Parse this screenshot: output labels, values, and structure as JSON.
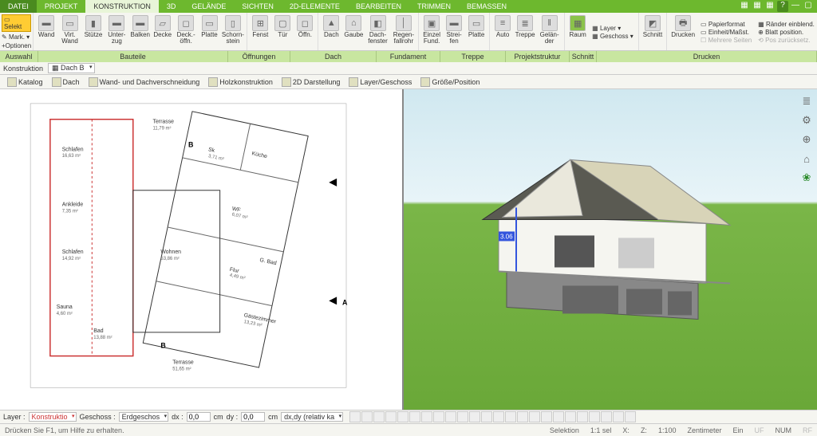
{
  "tabs": {
    "file": "DATEI",
    "list": [
      "PROJEKT",
      "KONSTRUKTION",
      "3D",
      "GELÄNDE",
      "SICHTEN",
      "2D-ELEMENTE",
      "BEARBEITEN",
      "TRIMMEN",
      "BEMASSEN"
    ],
    "active": "KONSTRUKTION"
  },
  "leftcol": {
    "select": "Selekt",
    "mark": "Mark.",
    "options": "+Optionen"
  },
  "ribbon": {
    "bauteile": [
      "Wand",
      "Virt. Wand",
      "Stütze",
      "Unter-zug",
      "Balken",
      "Decke",
      "Deck.-öffn.",
      "Platte",
      "Schorn-stein"
    ],
    "oeffnungen": [
      "Fenst",
      "Tür",
      "Öffn."
    ],
    "dach": [
      "Dach",
      "Gaube",
      "Dach-fenster",
      "Regen-fallrohr"
    ],
    "fundament": [
      "Einzel Fund.",
      "Strei-fen",
      "Platte"
    ],
    "treppe": [
      "Auto",
      "Treppe",
      "Gelän-der"
    ],
    "projekt": [
      "Raum"
    ],
    "projekt_side": {
      "layer": "Layer",
      "geschoss": "Geschoss"
    },
    "schnitt": [
      "Schnitt"
    ],
    "drucken": [
      "Drucken"
    ],
    "drucken_side": {
      "papier": "Papierformat",
      "einheit": "Einheit/Maßst.",
      "mehrere": "Mehrere Seiten",
      "raender": "Ränder einblend.",
      "blatt": "Blatt position.",
      "pos": "Pos zurücksetz."
    }
  },
  "groups": {
    "auswahl": "Auswahl",
    "bauteile": "Bauteile",
    "oeffnungen": "Öffnungen",
    "dach": "Dach",
    "fundament": "Fundament",
    "treppe": "Treppe",
    "projekt": "Projektstruktur",
    "schnitt": "Schnitt",
    "drucken": "Drucken"
  },
  "subbar": {
    "label": "Konstruktion",
    "value": "Dach B"
  },
  "toolbar2": {
    "katalog": "Katalog",
    "dach": "Dach",
    "wand": "Wand- und Dachverschneidung",
    "holz": "Holzkonstruktion",
    "d2": "2D Darstellung",
    "layer": "Layer/Geschoss",
    "groesse": "Größe/Position"
  },
  "rooms": {
    "terrasse1": {
      "name": "Terrasse",
      "area": "11,79 m²"
    },
    "schlafen1": {
      "name": "Schlafen",
      "area": "16,63 m²"
    },
    "sk": {
      "name": "Sk",
      "area": "3,71 m²"
    },
    "kueche": {
      "name": "Küche"
    },
    "ankleide": {
      "name": "Ankleide",
      "area": "7,35 m²"
    },
    "wf": {
      "name": "WF",
      "area": "6,07 m²"
    },
    "schlafen2": {
      "name": "Schlafen",
      "area": "14,92 m²"
    },
    "wohnen": {
      "name": "Wohnen",
      "area": "63,86 m²"
    },
    "flur": {
      "name": "Flur",
      "area": "4,49 m²"
    },
    "gbad": {
      "name": "G. Bad"
    },
    "sauna": {
      "name": "Sauna",
      "area": "4,60 m²"
    },
    "bad": {
      "name": "Bad",
      "area": "13,88 m²"
    },
    "gaeste": {
      "name": "Gästezimmer",
      "area": "13,23 m²"
    },
    "terrasse2": {
      "name": "Terrasse",
      "area": "51,65 m²"
    }
  },
  "sections": {
    "a": "A",
    "b": "B"
  },
  "coordbar": {
    "layer_lbl": "Layer :",
    "layer_val": "Konstruktio",
    "geschoss_lbl": "Geschoss :",
    "geschoss_val": "Erdgeschos",
    "dx": "dx :",
    "dy": "dy :",
    "dxdy": "dx,dy (relativ ka",
    "cm": "cm",
    "val": "0,0"
  },
  "status": {
    "help": "Drücken Sie F1, um Hilfe zu erhalten.",
    "selektion": "Selektion",
    "sel": "1:1 sel",
    "x": "X:",
    "z": "Z:",
    "scale": "1:100",
    "unit": "Zentimeter",
    "ein": "Ein",
    "uf": "UF",
    "num": "NUM",
    "rf": "RF"
  },
  "house_marker": "3.06"
}
